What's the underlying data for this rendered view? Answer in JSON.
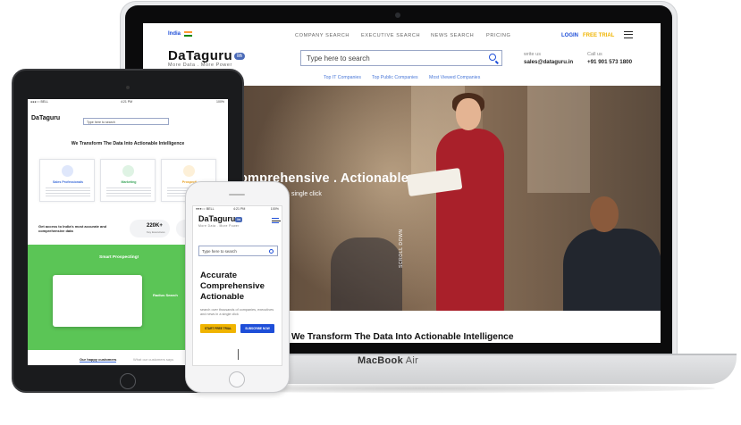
{
  "laptop": {
    "brand_prefix": "MacBook",
    "brand_suffix": "Air",
    "site": {
      "country": "India",
      "nav": [
        "COMPANY SEARCH",
        "EXECUTIVE SEARCH",
        "NEWS SEARCH",
        "PRICING"
      ],
      "login": "LOGIN",
      "free_trial": "FREE TRIAL",
      "logo_text": "DaTaguru",
      "logo_badge": "in",
      "tagline": "More Data . More Power",
      "search_placeholder": "Type here to search",
      "write_label": "write us",
      "write_value": "sales@dataguru.in",
      "call_label": "Call us",
      "call_value": "+91 901 573 1800",
      "sub_links": [
        "Top IT Companies",
        "Top Public Companies",
        "Most Viewed Companies"
      ],
      "hero_title": "omprehensive . Actionable",
      "hero_sub": "ves and news in a single click",
      "scroll_label": "SCROLL DOWN",
      "bottom_title": "We Transform The Data Into Actionable Intelligence"
    }
  },
  "tablet": {
    "status_left": "●●●○○ BELL",
    "status_time": "4:21 PM",
    "status_right": "100%",
    "logo_text": "DaTaguru",
    "search_placeholder": "Type here to search",
    "title": "We Transform The Data Into Actionable Intelligence",
    "cards": [
      {
        "label": "Sales Professionals",
        "color": "#3b6bd8"
      },
      {
        "label": "Marketing",
        "color": "#3aa45a"
      },
      {
        "label": "Prospecti",
        "color": "#e8a020"
      }
    ],
    "access_text": "Get access to India's most accurate and comprehensive data",
    "stat_value": "220K+",
    "stat_label": "Key Executives",
    "green_title": "Smart Prospecting!",
    "radius_label": "Radius Search",
    "happy": "Our happy customers",
    "happy_sub": "What our customers says"
  },
  "phone": {
    "status_left": "●●●○○ BELL",
    "status_time": "4:21 PM",
    "status_right": "100%",
    "logo_text": "DaTaguru",
    "logo_badge": "in",
    "tagline": "More Data . More Power",
    "search_placeholder": "Type here to search",
    "headline": "Accurate Comprehensive Actionable",
    "sub": "search over thousands of companies, executives and news in a single click",
    "btn_trial": "START FREE TRIAL",
    "btn_subscribe": "SUBSCRIBE NOW"
  },
  "colors": {
    "accent_blue": "#1e4ed8",
    "trial_yellow": "#f0b400",
    "green_section": "#5bc556",
    "dress_red": "#a9202a"
  }
}
